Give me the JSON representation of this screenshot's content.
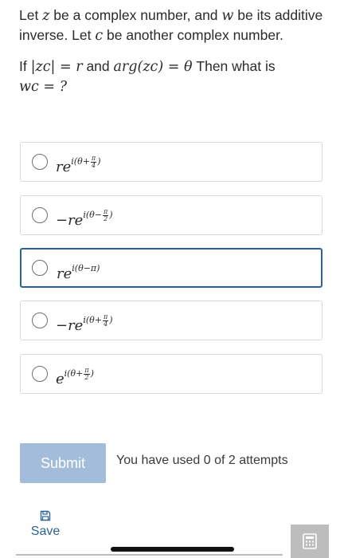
{
  "question": {
    "line1_a": "Let ",
    "z": "z",
    "line1_b": " be a complex number, and ",
    "w": "w",
    "line1_c": " be its additive inverse. Let ",
    "c": "c",
    "line1_d": " be another complex number.",
    "if": "If ",
    "abs_expr": "|zc| = r",
    "and": "and ",
    "arg_expr": "arg(zc) = θ",
    "then": "Then what is",
    "wc_expr": "wc = ?"
  },
  "options": [
    {
      "base": "re",
      "exp_pre": "i(θ+",
      "frac_num": "π",
      "frac_den": "4",
      "exp_post": ")",
      "selected": false
    },
    {
      "base": "−re",
      "exp_pre": "i(θ−",
      "frac_num": "π",
      "frac_den": "2",
      "exp_post": ")",
      "selected": false
    },
    {
      "base": "re",
      "exp_pre": "i(θ−π)",
      "frac_num": "",
      "frac_den": "",
      "exp_post": "",
      "selected": true
    },
    {
      "base": "−re",
      "exp_pre": "i(θ+",
      "frac_num": "π",
      "frac_den": "4",
      "exp_post": ")",
      "selected": false
    },
    {
      "base": "e",
      "exp_pre": "i(θ+",
      "frac_num": "π",
      "frac_den": "2",
      "exp_post": ")",
      "selected": false
    }
  ],
  "submit_label": "Submit",
  "attempts_text": "You have used 0 of 2 attempts",
  "save_label": "Save",
  "colors": {
    "accent": "#2a6496",
    "submit_bg": "#a3bcd9",
    "border": "#d9d9d9"
  }
}
